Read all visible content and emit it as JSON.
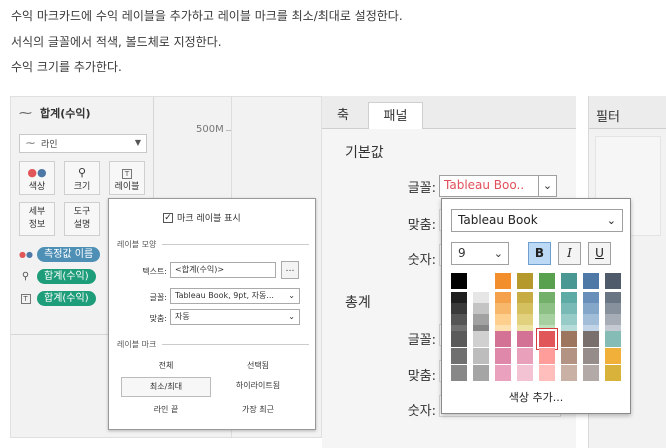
{
  "instructions": [
    "수익 마크카드에 수익 레이블을 추가하고 레이블 마크를 최소/최대로 설정한다.",
    "서식의 글꼴에서 적색, 볼드체로 지정한다.",
    "수익 크기를 추가한다."
  ],
  "marks_card": {
    "title": "합계(수익)",
    "mark_type": "라인",
    "buttons": [
      "색상",
      "크기",
      "레이블"
    ],
    "buttons_row2": [
      "세부\n정보",
      "도구\n설명"
    ],
    "pills": [
      {
        "label": "측정값 이름",
        "color": "#4e8fb6",
        "icon": "color-dots-icon"
      },
      {
        "label": "합계(수익)",
        "color": "#1e9d7a",
        "icon": "size-icon"
      },
      {
        "label": "합계(수익)",
        "color": "#1e9d7a",
        "icon": "label-icon"
      }
    ]
  },
  "axis_tick": "500M",
  "label_popup": {
    "show_labels": "마크 레이블 표시",
    "show_labels_checked": true,
    "section_appearance": "레이블 모양",
    "text_label": "텍스트:",
    "text_value": "<합계(수익)>",
    "font_label": "글꼴:",
    "font_value": "Tableau Book, 9pt, 자동...",
    "align_label": "맞춤:",
    "align_value": "자동",
    "section_marks": "레이블 마크",
    "options": [
      "전체",
      "선택됨",
      "최소/최대",
      "하이라이트됨",
      "라인 끝",
      "가장 최근"
    ],
    "selected_option": "최소/최대"
  },
  "format_pane": {
    "tabs": [
      "축",
      "패널"
    ],
    "active_tab": "패널",
    "section_default": "기본값",
    "section_totals": "총계",
    "font_label": "글꼴:",
    "align_label": "맞춤:",
    "number_label": "숫자:",
    "font_value": "Tableau Boo..",
    "font_value_color": "#e0505a"
  },
  "filter_panel": {
    "title": "필터"
  },
  "font_popup": {
    "family": "Tableau Book",
    "size": "9",
    "bold_label": "B",
    "italic_label": "I",
    "underline_label": "U",
    "bold_active": true,
    "add_color_label": "색상 추가...",
    "selected_color": "#e15759",
    "palette_columns": [
      [
        "#000000",
        "#1f1f1f",
        "#3a3a3a",
        "#555555",
        "#707070"
      ],
      [
        "#ffffff",
        "#e6e6e6",
        "#c4c4c4",
        "#a2a2a2",
        "#858585"
      ],
      [
        "#f28e2b",
        "#f5a04b",
        "#f8b86c",
        "#ffcf8e",
        "#ffe0b0"
      ],
      [
        "#b6992d",
        "#c7ab43",
        "#d4c05f",
        "#e1d17e",
        "#ede2a2"
      ],
      [
        "#59a14f",
        "#73b06a",
        "#8cc084",
        "#a6d0a0",
        "#c3e0bc"
      ],
      [
        "#499894",
        "#5eaaa5",
        "#79bab6",
        "#96cbc8",
        "#b6dcd9"
      ],
      [
        "#4e79a7",
        "#688fb9",
        "#84a6c9",
        "#a2bdd8",
        "#c2d4e7"
      ],
      [
        "#4f5b6a",
        "#6a7584",
        "#87909d",
        "#a6adb7",
        "#c5cad2"
      ]
    ],
    "palette_columns_b": [
      [
        "#5a5a5a",
        "#707070",
        "#888888"
      ],
      [
        "#d0d0d0",
        "#bdbdbd",
        "#a5a5a5"
      ],
      [
        "#d37295",
        "#e088a9",
        "#eaa1bd"
      ],
      [
        "#d37295",
        "#e8a0bb",
        "#f3c2d3"
      ],
      [
        "#e15759",
        "#ff9d9a",
        "#ffbdbb"
      ],
      [
        "#9d7660",
        "#b39383",
        "#c9b1a6"
      ],
      [
        "#79706e",
        "#968c8a",
        "#b3aaa8"
      ],
      [
        "#86bcb6",
        "#f0b03a",
        "#d9b23b"
      ]
    ]
  }
}
